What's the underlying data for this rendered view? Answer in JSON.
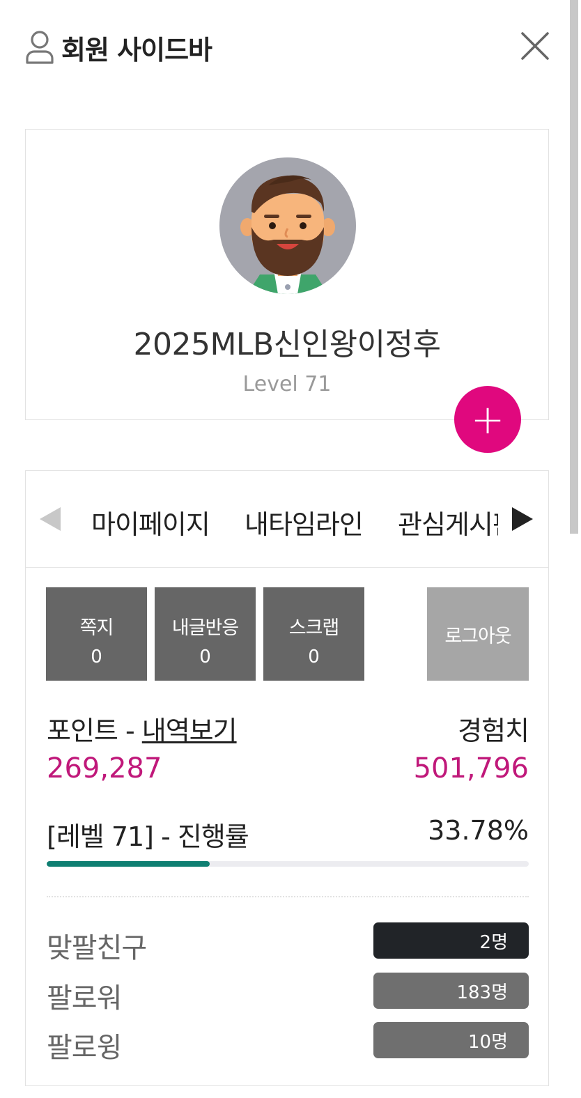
{
  "header": {
    "title": "회원 사이드바",
    "user_icon": "user-icon",
    "close_icon": "close-icon"
  },
  "profile": {
    "nickname": "2025MLB신인왕이정후",
    "level": "Level 71",
    "avatar": "bearded-man-avatar",
    "plus_label": "+"
  },
  "tabs": {
    "items": [
      "마이페이지",
      "내타임라인",
      "관심게시판"
    ],
    "prev_icon": "triangle-left-icon",
    "next_icon": "triangle-right-icon"
  },
  "stats": [
    {
      "label": "쪽지",
      "value": "0"
    },
    {
      "label": "내글반응",
      "value": "0"
    },
    {
      "label": "스크랩",
      "value": "0"
    }
  ],
  "logout_label": "로그아웃",
  "points": {
    "label": "포인트 - ",
    "link": "내역보기",
    "value": "269,287",
    "exp_label": "경험치",
    "exp_value": "501,796"
  },
  "progress": {
    "label": "[레벨 71] - 진행률",
    "percent_text": "33.78%",
    "percent": 33.78
  },
  "relations": [
    {
      "label": "맞팔친구",
      "count": "2명",
      "color": "#212428"
    },
    {
      "label": "팔로워",
      "count": "183명",
      "color": "#6f6f6f"
    },
    {
      "label": "팔로윙",
      "count": "10명",
      "color": "#6f6f6f"
    }
  ],
  "colors": {
    "accent": "#e0087e",
    "value_text": "#c0187a",
    "progress": "#0f7f72"
  }
}
